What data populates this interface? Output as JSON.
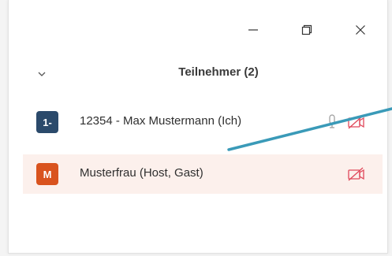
{
  "window": {
    "minimize_icon": "minimize-icon",
    "restore_icon": "restore-icon",
    "close_icon": "close-icon"
  },
  "participants_panel": {
    "collapse_icon": "chevron-down-icon",
    "title": "Teilnehmer (2)",
    "participants": [
      {
        "avatar_text": "1-",
        "avatar_color": "#2b4a6b",
        "name": "12354 - Max Mustermann (Ich)",
        "mic_icon": "microphone-icon",
        "camera_icon": "camera-off-icon",
        "highlighted": false
      },
      {
        "avatar_text": "M",
        "avatar_color": "#d9531e",
        "name": "Musterfrau (Host, Gast)",
        "camera_icon": "camera-off-icon",
        "highlighted": true
      }
    ]
  },
  "colors": {
    "annotation_line": "#3a9ab8",
    "camera_off": "#e0485a",
    "highlight_row": "#fcf0ec"
  }
}
